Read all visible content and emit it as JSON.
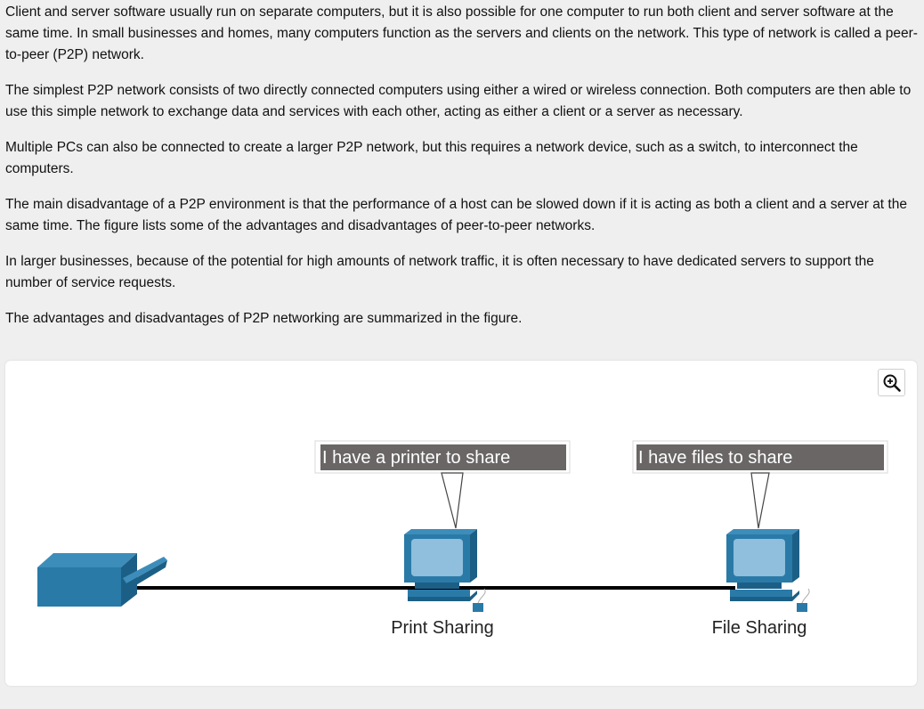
{
  "paragraphs": [
    "Client and server software usually run on separate computers, but it is also possible for one computer to run both client and server software at the same time. In small businesses and homes, many computers function as the servers and clients on the network. This type of network is called a peer-to-peer (P2P) network.",
    "The simplest P2P network consists of two directly connected computers using either a wired or wireless connection. Both computers are then able to use this simple network to exchange data and services with each other, acting as either a client or a server as necessary.",
    "Multiple PCs can also be connected to create a larger P2P network, but this requires a network device, such as a switch, to interconnect the computers.",
    "The main disadvantage of a P2P environment is that the performance of a host can be slowed down if it is acting as both a client and a server at the same time. The figure lists some of the advantages and disadvantages of peer-to-peer networks.",
    "In larger businesses, because of the potential for high amounts of network traffic, it is often necessary to have dedicated servers to support the number of service requests.",
    "The advantages and disadvantages of P2P networking are summarized in the figure."
  ],
  "figure": {
    "zoom_icon": "zoom-in-icon",
    "callouts": {
      "printer": "I have a printer to share",
      "files": "I have files to share"
    },
    "labels": {
      "print_sharing": "Print Sharing",
      "file_sharing": "File Sharing"
    },
    "colors": {
      "device_blue": "#2a7aa8",
      "device_dark": "#1c5f86",
      "screen": "#8fbfdc",
      "callout_bg": "#6a6666",
      "cable": "#000000"
    }
  }
}
